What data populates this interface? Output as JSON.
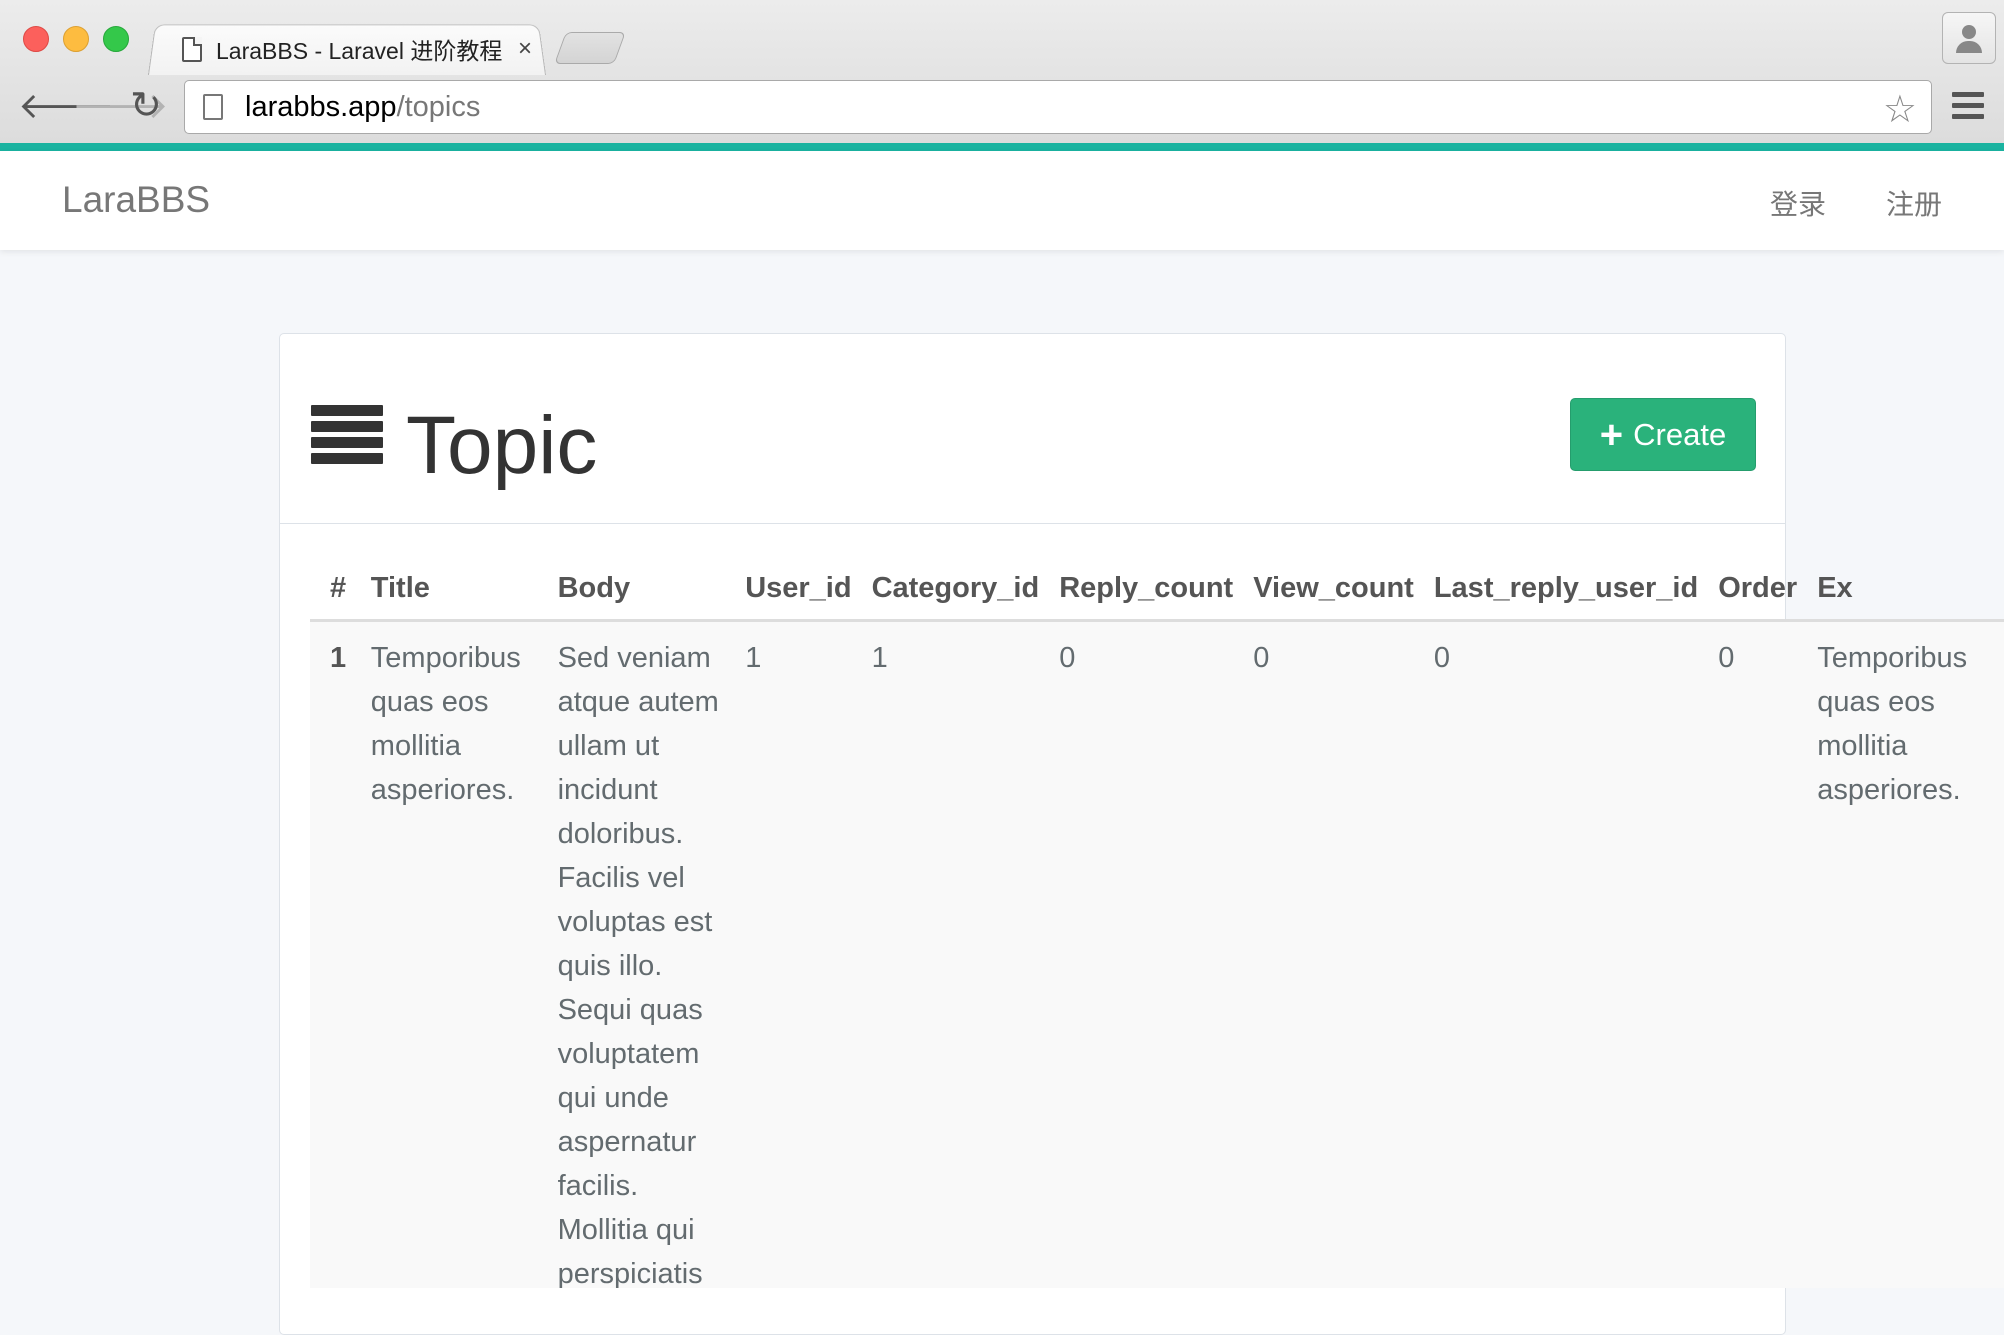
{
  "browser": {
    "tab_title": "LaraBBS - Laravel 进阶教程",
    "tab_close": "×",
    "url_host": "larabbs.app",
    "url_path": "/topics",
    "back_glyph": "🡐",
    "forward_glyph": "🡒",
    "reload_glyph": "↻",
    "star_glyph": "☆"
  },
  "navbar": {
    "brand": "LaraBBS",
    "login": "登录",
    "register": "注册",
    "accent_color": "#1ab3a0"
  },
  "panel": {
    "title": "Topic",
    "title_icon": "list-icon",
    "create_label": "Create",
    "create_icon": "plus-icon",
    "create_color": "#2ab27b"
  },
  "table": {
    "columns": [
      "#",
      "Title",
      "Body",
      "User_id",
      "Category_id",
      "Reply_count",
      "View_count",
      "Last_reply_user_id",
      "Order",
      "Ex"
    ],
    "rows": [
      {
        "id": "1",
        "title": "Temporibus quas eos mollitia asperiores.",
        "body": "Sed veniam atque autem ullam ut incidunt doloribus. Facilis vel voluptas est quis illo. Sequi quas voluptatem qui unde aspernatur facilis. Mollitia qui perspiciatis et amet.",
        "user_id": "1",
        "category_id": "1",
        "reply_count": "0",
        "view_count": "0",
        "last_reply_user_id": "0",
        "order": "0",
        "excerpt": "Temporibus quas eos mollitia asperiores."
      }
    ]
  }
}
